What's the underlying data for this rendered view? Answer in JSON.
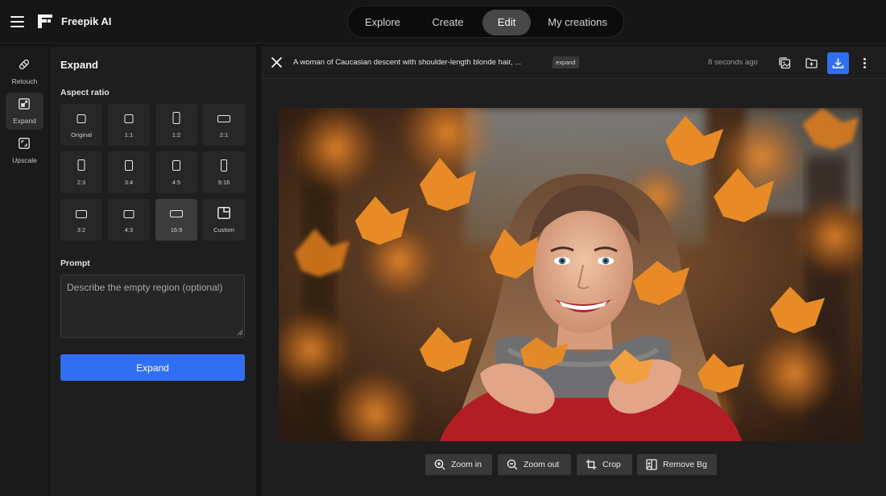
{
  "app": {
    "name": "Freepik AI"
  },
  "nav": {
    "tabs": [
      "Explore",
      "Create",
      "Edit",
      "My creations"
    ],
    "active": "Edit"
  },
  "rail": {
    "items": [
      {
        "label": "Retouch",
        "icon": "bandage-icon"
      },
      {
        "label": "Expand",
        "icon": "expand-icon"
      },
      {
        "label": "Upscale",
        "icon": "upscale-icon"
      }
    ],
    "active": "Expand"
  },
  "panel": {
    "title": "Expand",
    "aspect_label": "Aspect ratio",
    "ratios": [
      "Original",
      "1:1",
      "1:2",
      "2:1",
      "2:3",
      "3:4",
      "4:5",
      "9:16",
      "3:2",
      "4:3",
      "16:9",
      "Custom"
    ],
    "selected_ratio": "16:9",
    "prompt_label": "Prompt",
    "prompt_placeholder": "Describe the empty region (optional)",
    "prompt_value": "",
    "submit_label": "Expand"
  },
  "image": {
    "title": "A woman of Caucasian descent with shoulder-length blonde hair, ...",
    "tag": "expand",
    "timestamp": "8 seconds ago"
  },
  "toolbar": {
    "zoom_in": "Zoom in",
    "zoom_out": "Zoom out",
    "crop": "Crop",
    "remove_bg": "Remove Bg"
  },
  "colors": {
    "accent": "#2f6ff0",
    "background": "#141414",
    "panel": "#1e1e1e"
  }
}
